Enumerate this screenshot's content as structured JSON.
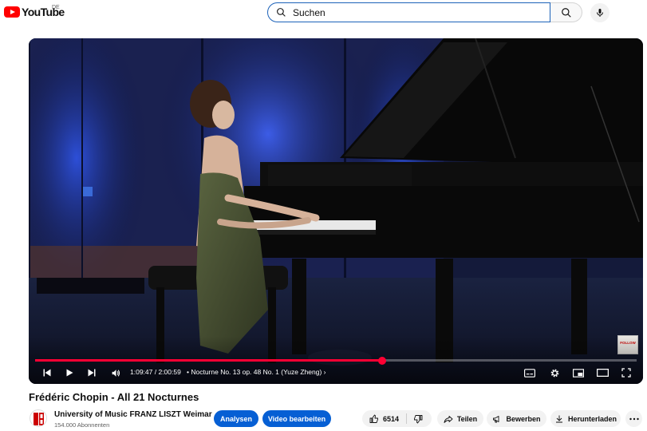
{
  "header": {
    "logo_text": "YouTube",
    "country_code": "DE",
    "search_placeholder": "Suchen",
    "search_value": ""
  },
  "player": {
    "current_time": "1:09:47",
    "duration": "2:00:59",
    "time_display": "1:09:47 / 2:00:59",
    "chapter_title": "• Nocturne No. 13 op. 48 No. 1 (Yuze Zheng)",
    "chapter_arrow": "›",
    "progress_fraction": 0.577,
    "overlay_badge": "FOLLOW",
    "accent_color": "#ff0033"
  },
  "video": {
    "title": "Frédéric Chopin - All 21 Nocturnes",
    "channel_name": "University of Music FRANZ LISZT Weimar",
    "subscribers": "154.000 Abonnenten"
  },
  "actions": {
    "analysen": "Analysen",
    "edit_video": "Video bearbeiten",
    "likes": "6514",
    "share": "Teilen",
    "promote": "Bewerben",
    "download": "Herunterladen"
  },
  "icons": [
    "youtube-logo-icon",
    "search-icon",
    "mic-icon",
    "previous-icon",
    "play-icon",
    "next-icon",
    "volume-icon",
    "chevron-right-icon",
    "subtitles-icon",
    "settings-gear-icon",
    "miniplayer-icon",
    "theater-mode-icon",
    "fullscreen-icon",
    "thumbs-up-icon",
    "thumbs-down-icon",
    "share-icon",
    "promote-megaphone-icon",
    "download-icon",
    "more-icon"
  ],
  "colors": {
    "brand_red": "#ff0000",
    "primary_blue": "#065fd4",
    "search_border": "#1c62b9"
  }
}
